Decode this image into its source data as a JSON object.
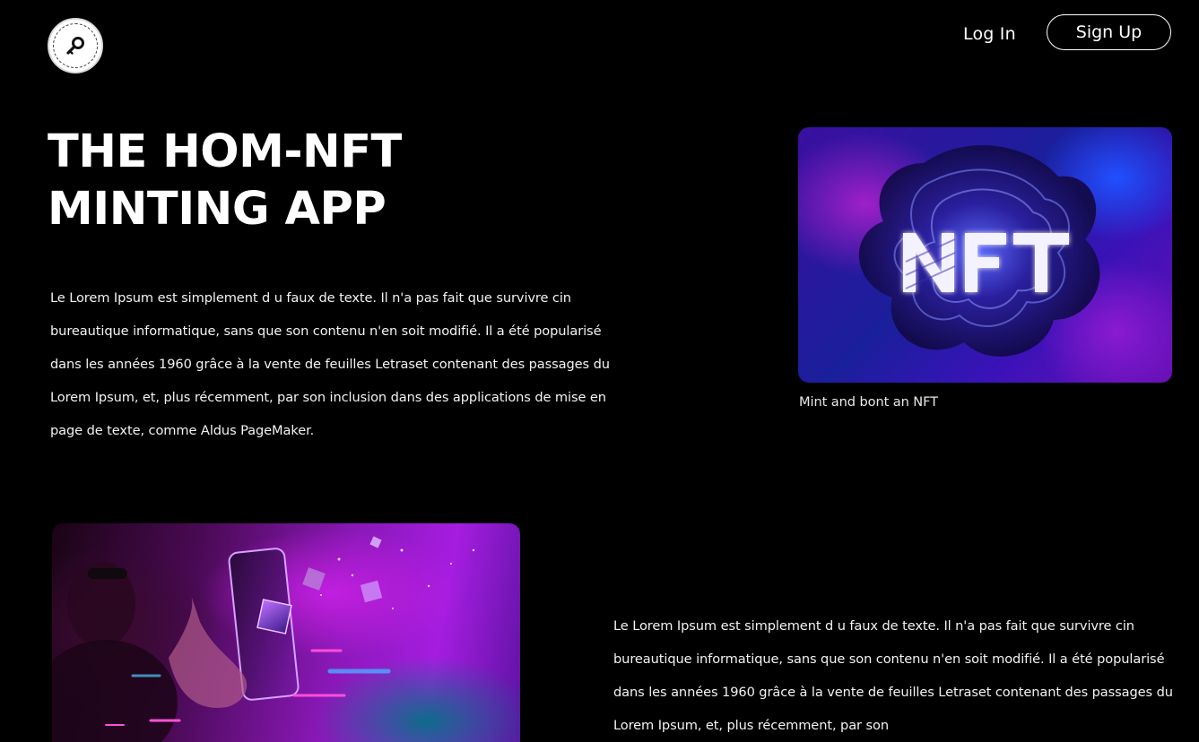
{
  "header": {
    "logo_icon": "key-icon",
    "login_label": "Log In",
    "signup_label": "Sign Up"
  },
  "hero": {
    "title_line_1": "THE HOM-NFT",
    "title_line_2": "MINTING APP",
    "paragraph": "Le Lorem Ipsum est simplement d u faux de texte. Il n'a pas fait que survivre cin bureautique informatique, sans que son contenu n'en soit modifié. Il a été popularisé dans les années 1960 grâce à la vente de feuilles Letraset contenant des passages du Lorem Ipsum, et, plus récemment, par son inclusion dans des applications de mise en page de texte, comme Aldus PageMaker."
  },
  "feature_card": {
    "image_text": "NFT",
    "caption": "Mint and bont an NFT"
  },
  "second_section": {
    "paragraph": "Le Lorem Ipsum est simplement d u faux de texte. Il n'a pas fait que survivre cin bureautique informatique, sans que son contenu n'en soit modifié. Il a été popularisé dans les années 1960 grâce à la vente de feuilles Letraset contenant des passages du Lorem Ipsum, et, plus récemment, par son"
  },
  "colors": {
    "background": "#000000",
    "text": "#ffffff",
    "accent_purple": "#a51de0",
    "accent_blue": "#2050ff"
  }
}
